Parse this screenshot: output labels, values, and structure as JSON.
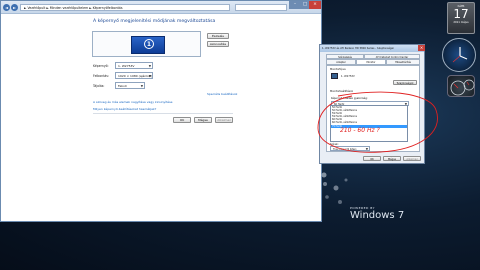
{
  "main_window": {
    "breadcrumb": "► Vezérlőpult ► Minden vezérlőpultelem ► Képernyőfelbontás",
    "heading": "A képernyő megjelenítési módjának megváltoztatása",
    "monitor_number": "1",
    "detect_button": "Észlelés",
    "identify_button": "Azonosítás",
    "display_label": "Képernyő:",
    "display_value": "1. W2753V",
    "resolution_label": "Felbontás:",
    "resolution_value": "1920 × 1080 (ajánlott)",
    "orientation_label": "Tájolás:",
    "orientation_value": "Fekvő",
    "advanced_link": "Speciális beállítások",
    "link_text_size": "A szöveg és más elemek nagyítása vagy kicsinyítése",
    "link_which_settings": "Milyen képernyő-beállításokat használjak?",
    "ok_button": "OK",
    "cancel_button": "Mégse",
    "apply_button": "Alkalmaz"
  },
  "gadgets": {
    "calendar_day": "17",
    "calendar_weekday": "hétfő",
    "calendar_month": "2011 május"
  },
  "dialog": {
    "title": "1. W2753V és ATI Radeon HD 5800 Series - tulajdonságai",
    "tabs_row1": [
      "Színkezelés",
      "ATI Catalyst Control Center"
    ],
    "tabs_row2": [
      "Adapter",
      "Monitor",
      "Hibaelhárítás"
    ],
    "monitor_type_label": "Monitortípus",
    "monitor_type_value": "1. W2753V",
    "properties_button": "Tulajdonságok",
    "monitor_settings_label": "Monitorbeállítások",
    "refresh_label": "Képernyő-frissítési gyakoriság:",
    "refresh_selected": "60 Hertz",
    "refresh_options": [
      "50 Hertz",
      "50 Hertz, váltottsoros",
      "59 Hertz",
      "59 Hertz, váltottsoros",
      "60 Hertz",
      "60 Hertz, váltottsoros",
      "75 Hertz"
    ],
    "highlighted_index": 6,
    "colors_label": "Színek:",
    "colors_value": "True Color (32 bites)",
    "ok_button": "OK",
    "cancel_button": "Mégse",
    "apply_button": "Alkalmaz"
  },
  "annotation": {
    "text": "210 - 60 Hz ?",
    "color": "#e02020"
  },
  "desktop": {
    "powered_by": "POWERED BY",
    "os_name": "Windows 7"
  },
  "colors": {
    "accent": "#1e4a96",
    "link": "#1565c0",
    "selection": "#3399ff"
  }
}
